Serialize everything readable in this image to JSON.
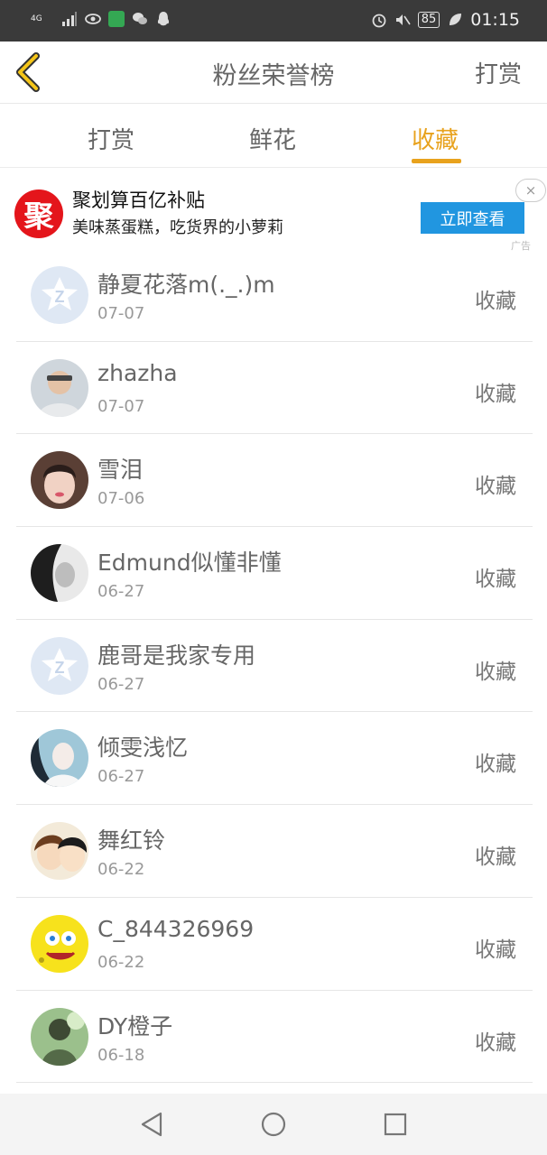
{
  "status_bar": {
    "network": "4G",
    "battery": "85",
    "time": "01:15"
  },
  "header": {
    "title": "粉丝荣誉榜",
    "action": "打赏"
  },
  "tabs": [
    {
      "label": "打赏",
      "active": false
    },
    {
      "label": "鲜花",
      "active": false
    },
    {
      "label": "收藏",
      "active": true
    }
  ],
  "ad": {
    "logo_text": "聚",
    "title": "聚划算百亿补贴",
    "description": "美味蒸蛋糕，吃货界的小萝莉",
    "button": "立即查看",
    "tag": "广告",
    "close": "×"
  },
  "fans": [
    {
      "name": "静夏花落m(._.)m",
      "date": "07-07",
      "action": "收藏",
      "avatar": "default-q-icon"
    },
    {
      "name": "zhazha",
      "date": "07-07",
      "action": "收藏",
      "avatar": "photo"
    },
    {
      "name": "雪泪",
      "date": "07-06",
      "action": "收藏",
      "avatar": "photo"
    },
    {
      "name": "Edmund似懂非懂",
      "date": "06-27",
      "action": "收藏",
      "avatar": "photo"
    },
    {
      "name": "鹿哥是我家专用",
      "date": "06-27",
      "action": "收藏",
      "avatar": "default-q-icon"
    },
    {
      "name": "倾雯浅忆",
      "date": "06-27",
      "action": "收藏",
      "avatar": "photo"
    },
    {
      "name": "舞红铃",
      "date": "06-22",
      "action": "收藏",
      "avatar": "photo"
    },
    {
      "name": "C_844326969",
      "date": "06-22",
      "action": "收藏",
      "avatar": "photo"
    },
    {
      "name": "DY橙子",
      "date": "06-18",
      "action": "收藏",
      "avatar": "photo"
    }
  ],
  "colors": {
    "accent": "#e8a21d",
    "ad_button": "#2196e0",
    "ad_logo": "#e4151b",
    "status_bar": "#3a3a3a"
  }
}
